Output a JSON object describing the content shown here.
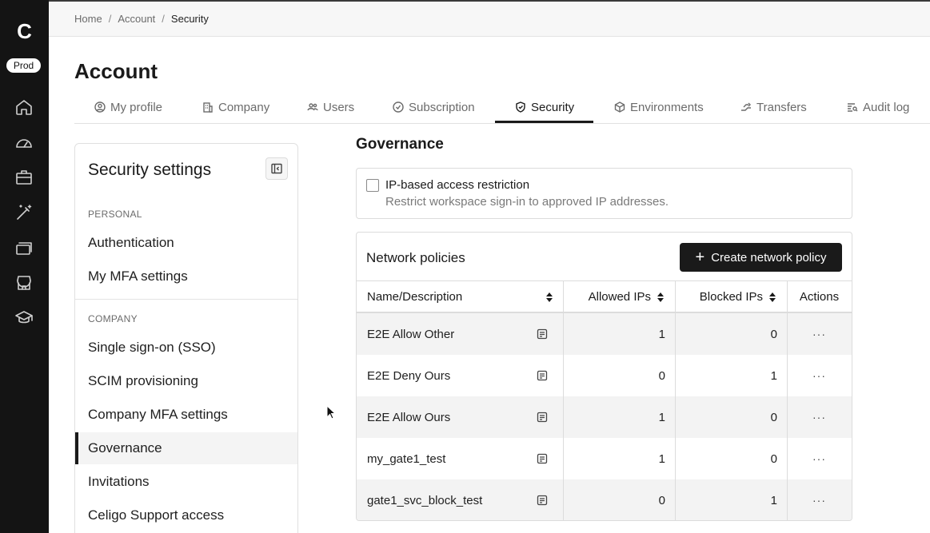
{
  "rail": {
    "logo": "C",
    "env_badge": "Prod",
    "icons": [
      "home-icon",
      "dashboard-icon",
      "briefcase-icon",
      "magic-wand-icon",
      "stack-icon",
      "store-icon",
      "graduation-cap-icon"
    ]
  },
  "breadcrumb": [
    "Home",
    "Account",
    "Security"
  ],
  "page_title": "Account",
  "tabs": [
    {
      "label": "My profile",
      "icon": "user-circle-icon"
    },
    {
      "label": "Company",
      "icon": "building-icon"
    },
    {
      "label": "Users",
      "icon": "users-icon"
    },
    {
      "label": "Subscription",
      "icon": "check-badge-icon"
    },
    {
      "label": "Security",
      "icon": "shield-icon",
      "active": true
    },
    {
      "label": "Environments",
      "icon": "cube-icon"
    },
    {
      "label": "Transfers",
      "icon": "transfer-icon"
    },
    {
      "label": "Audit log",
      "icon": "list-search-icon"
    }
  ],
  "side_panel": {
    "title": "Security settings",
    "sections": [
      {
        "label": "PERSONAL",
        "items": [
          "Authentication",
          "My MFA settings"
        ]
      },
      {
        "label": "COMPANY",
        "items": [
          "Single sign-on (SSO)",
          "SCIM provisioning",
          "Company MFA settings",
          "Governance",
          "Invitations",
          "Celigo Support access"
        ]
      }
    ],
    "active_item": "Governance"
  },
  "governance": {
    "title": "Governance",
    "ip_restriction": {
      "title": "IP-based access restriction",
      "description": "Restrict workspace sign-in to approved IP addresses.",
      "checked": false
    },
    "network_policies": {
      "title": "Network policies",
      "create_button": "Create network policy",
      "columns": [
        "Name/Description",
        "Allowed IPs",
        "Blocked IPs",
        "Actions"
      ],
      "rows": [
        {
          "name": "E2E Allow Other",
          "allowed": "1",
          "blocked": "0",
          "actions": "···"
        },
        {
          "name": "E2E Deny Ours",
          "allowed": "0",
          "blocked": "1",
          "actions": "···"
        },
        {
          "name": "E2E Allow Ours",
          "allowed": "1",
          "blocked": "0",
          "actions": "···"
        },
        {
          "name": "my_gate1_test",
          "allowed": "1",
          "blocked": "0",
          "actions": "···"
        },
        {
          "name": "gate1_svc_block_test",
          "allowed": "0",
          "blocked": "1",
          "actions": "···"
        }
      ]
    }
  },
  "colors": {
    "rail_bg": "#141414",
    "primary_button": "#1a1a1a",
    "row_stripe": "#f3f3f3"
  }
}
